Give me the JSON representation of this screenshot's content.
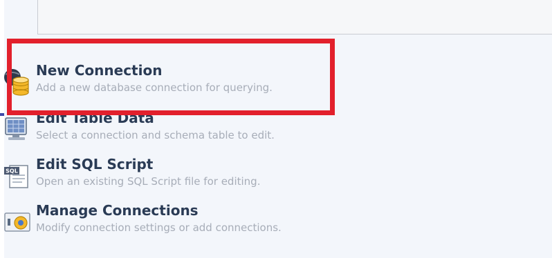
{
  "tasks": [
    {
      "title": "New Connection",
      "description": "Add a new database connection for querying.",
      "icon": "database-icon"
    },
    {
      "title": "Edit Table Data",
      "description": "Select a connection and schema table to edit.",
      "icon": "table-monitor-icon"
    },
    {
      "title": "Edit SQL Script",
      "description": "Open an existing SQL Script file for editing.",
      "icon": "sql-file-icon"
    },
    {
      "title": "Manage Connections",
      "description": "Modify connection settings or add connections.",
      "icon": "manage-connections-icon"
    }
  ],
  "sql_icon_text": "SQL",
  "highlight_color": "#e2202c",
  "title_color": "#2a3b55",
  "description_color": "#a7adb8"
}
